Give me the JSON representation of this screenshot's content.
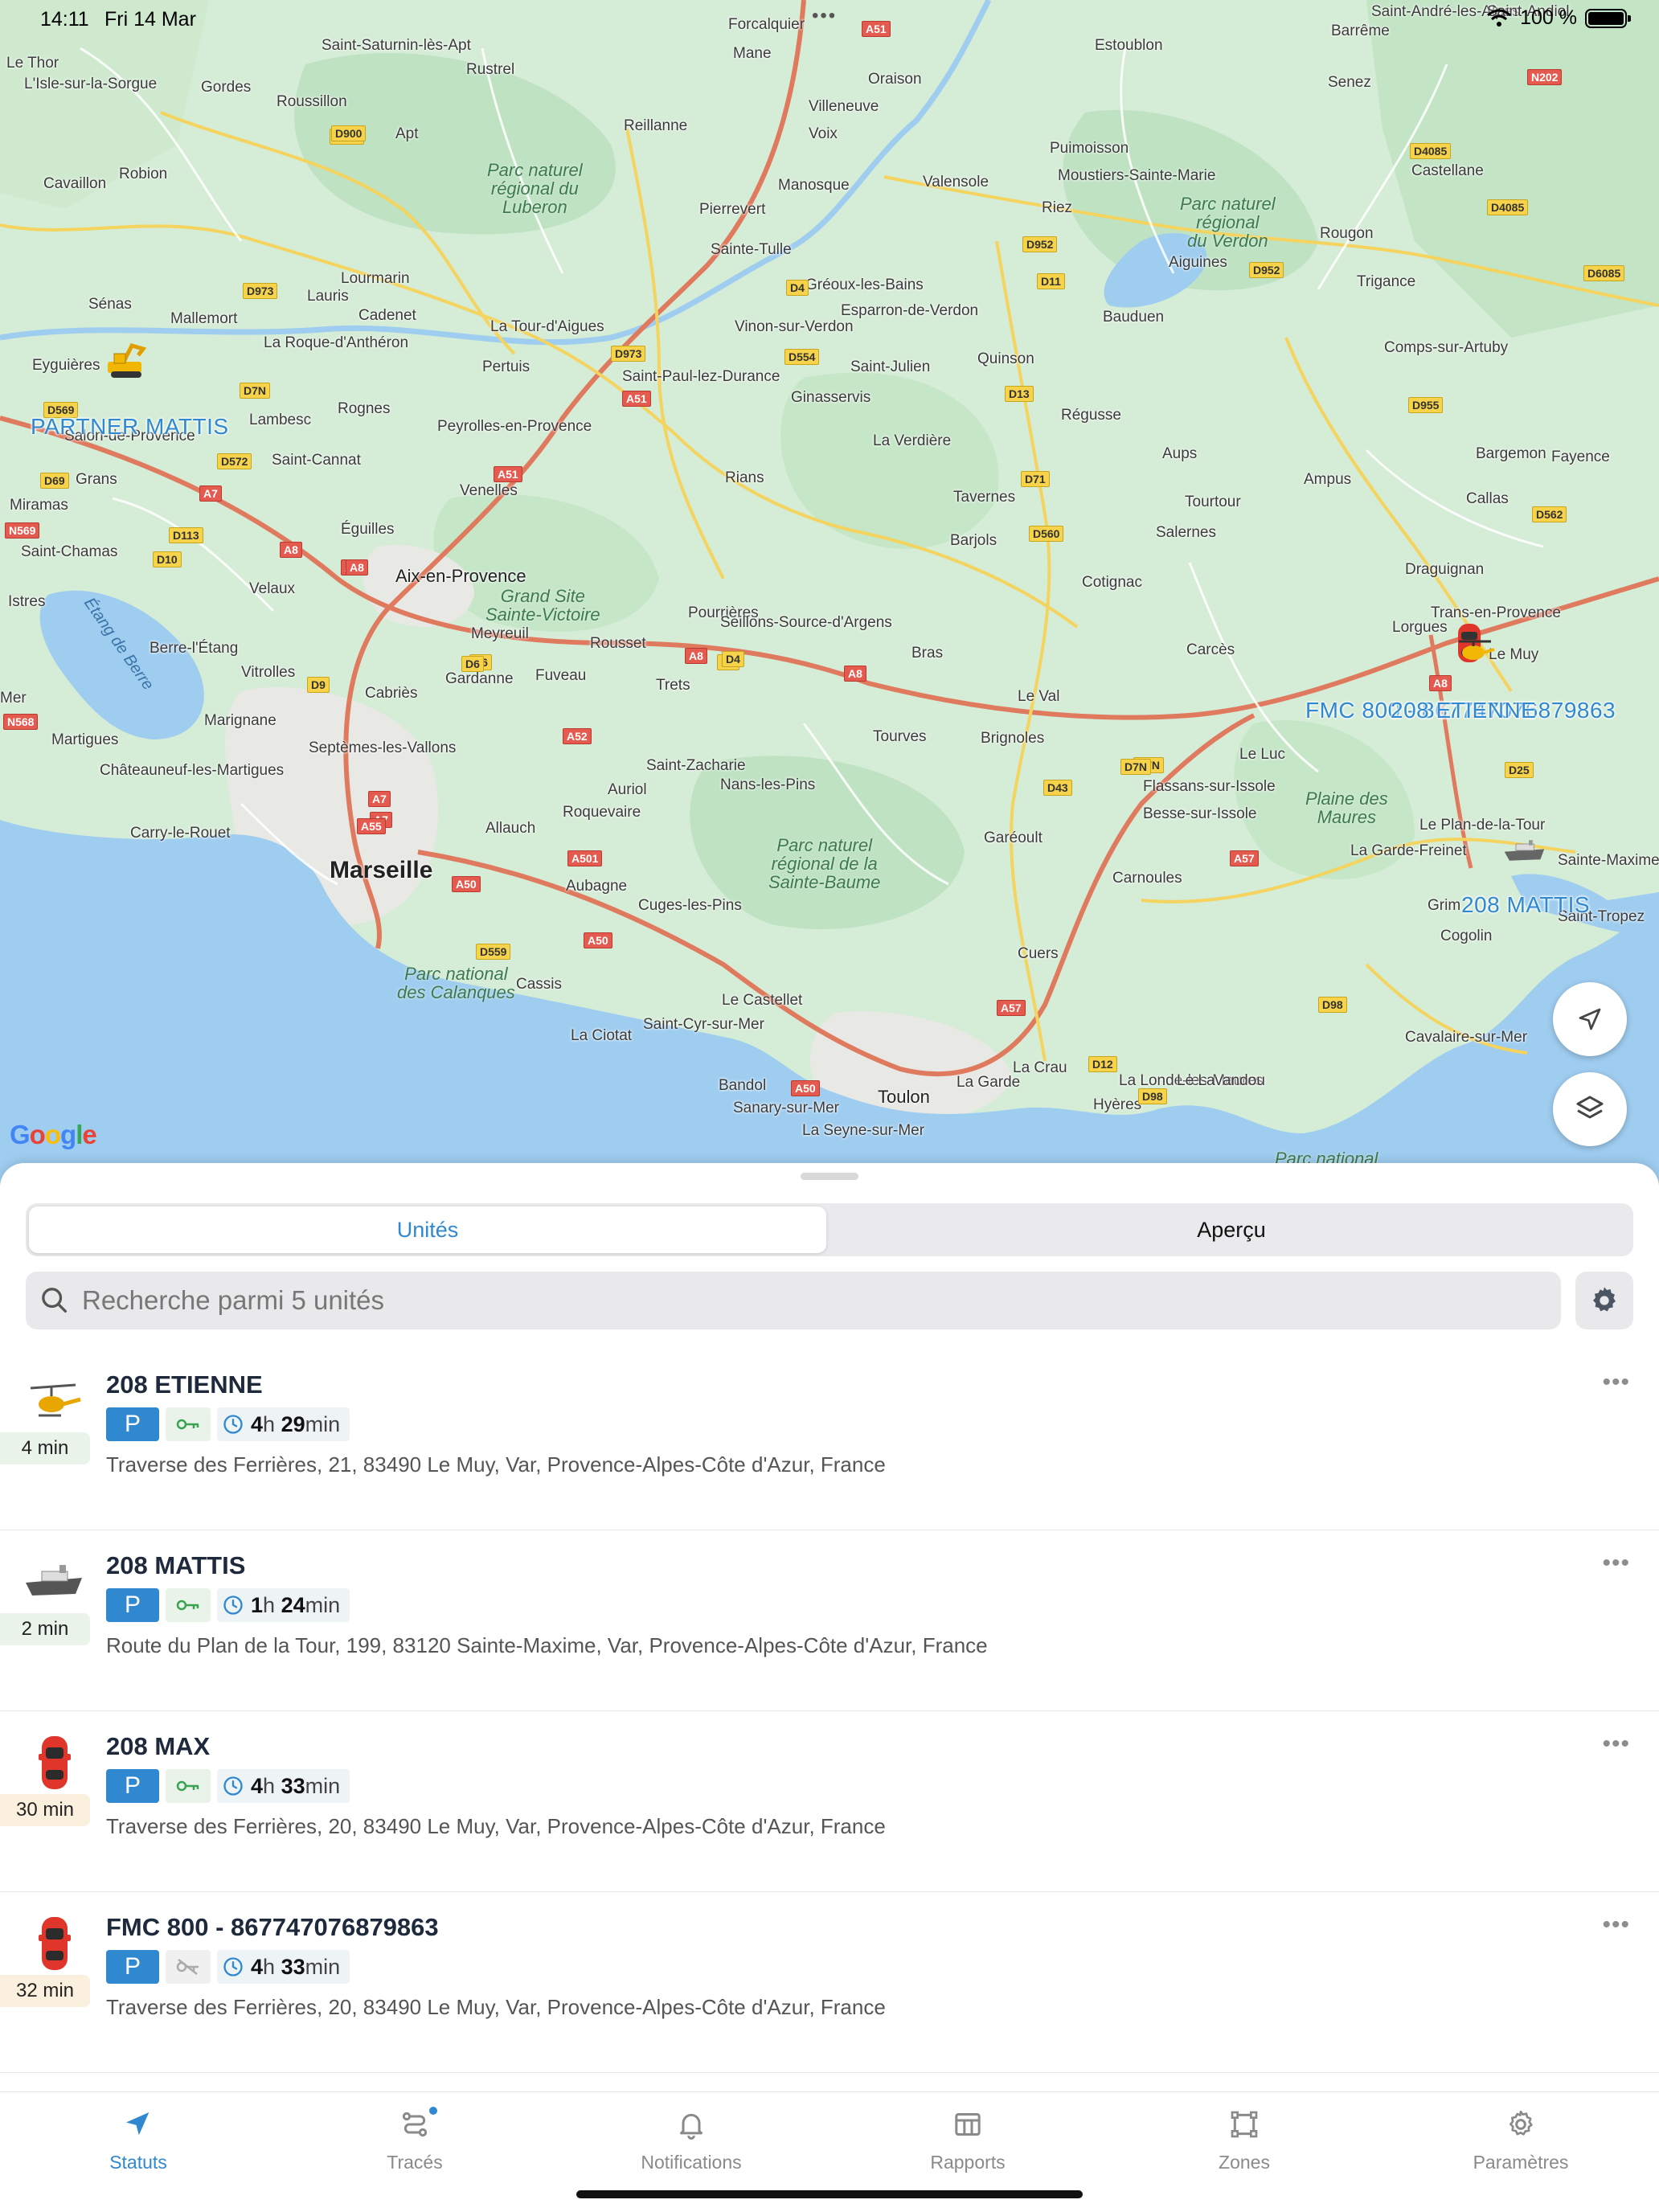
{
  "statusbar": {
    "time": "14:11",
    "date": "Fri 14 Mar",
    "battery": "100 %"
  },
  "map": {
    "places": [
      {
        "t": "Le Thor"
      },
      {
        "t": "L'Isle-sur-la-Sorgue"
      },
      {
        "t": "Gordes"
      },
      {
        "t": "Saint-Saturnin-lès-Apt"
      },
      {
        "t": "Rustrel"
      },
      {
        "t": "Roussillon"
      },
      {
        "t": "Apt"
      },
      {
        "t": "Reillanne"
      },
      {
        "t": "Forcalquier"
      },
      {
        "t": "Mane"
      },
      {
        "t": "Oraison"
      },
      {
        "t": "Villeneuve"
      },
      {
        "t": "Voix"
      },
      {
        "t": "Estoublon"
      },
      {
        "t": "Barrême"
      },
      {
        "t": "Senez"
      },
      {
        "t": "Saint-André-les-Alpes"
      },
      {
        "t": "Robion"
      },
      {
        "t": "Cavaillon"
      },
      {
        "t": "Manosque"
      },
      {
        "t": "Valensole"
      },
      {
        "t": "Pierrevert"
      },
      {
        "t": "Puimoisson"
      },
      {
        "t": "Moustiers-Sainte-Marie"
      },
      {
        "t": "Castellane"
      },
      {
        "t": "Riez"
      },
      {
        "t": "Sainte-Tulle"
      },
      {
        "t": "Rougon"
      },
      {
        "t": "Gréoux-les-Bains"
      },
      {
        "t": "Esparron-de-Verdon"
      },
      {
        "t": "Aiguines"
      },
      {
        "t": "Trigance"
      },
      {
        "t": "Bauduen"
      },
      {
        "t": "Lourmarin"
      },
      {
        "t": "Lauris"
      },
      {
        "t": "Cadenet"
      },
      {
        "t": "Sénas"
      },
      {
        "t": "Mallemort"
      },
      {
        "t": "La Roque-d'Anthéron"
      },
      {
        "t": "La Tour-d'Aigues"
      },
      {
        "t": "Vinon-sur-Verdon"
      },
      {
        "t": "Quinson"
      },
      {
        "t": "Comps-sur-Artuby"
      },
      {
        "t": "Eyguières"
      },
      {
        "t": "Pertuis"
      },
      {
        "t": "Saint-Paul-lez-Durance"
      },
      {
        "t": "Saint-Julien"
      },
      {
        "t": "Ginasservis"
      },
      {
        "t": "Lambesc"
      },
      {
        "t": "Rognes"
      },
      {
        "t": "Salon-de-Provence"
      },
      {
        "t": "Peyrolles-en-Provence"
      },
      {
        "t": "Régusse"
      },
      {
        "t": "La Verdière"
      },
      {
        "t": "Aups"
      },
      {
        "t": "Saint-Cannat"
      },
      {
        "t": "Bargemon"
      },
      {
        "t": "Fayence"
      },
      {
        "t": "Grans"
      },
      {
        "t": "Venelles"
      },
      {
        "t": "Rians"
      },
      {
        "t": "Ampus"
      },
      {
        "t": "Tavernes"
      },
      {
        "t": "Callas"
      },
      {
        "t": "Miramas"
      },
      {
        "t": "Éguilles"
      },
      {
        "t": "Barjols"
      },
      {
        "t": "Tourtour"
      },
      {
        "t": "Salernes"
      },
      {
        "t": "Saint-Chamas"
      },
      {
        "t": "Draguignan"
      },
      {
        "t": "Velaux"
      },
      {
        "t": "Cotignac"
      },
      {
        "t": "Istres"
      },
      {
        "t": "Pourrières"
      },
      {
        "t": "Trans-en-Provence"
      },
      {
        "t": "Meyreuil"
      },
      {
        "t": "Seillons-Source-d'Argens"
      },
      {
        "t": "Lorgues"
      },
      {
        "t": "Berre-l'Étang"
      },
      {
        "t": "Rousset"
      },
      {
        "t": "Carcès"
      },
      {
        "t": "Bras"
      },
      {
        "t": "Le Muy"
      },
      {
        "t": "Vitrolles"
      },
      {
        "t": "Gardanne"
      },
      {
        "t": "Fuveau"
      },
      {
        "t": "Trets"
      },
      {
        "t": "Cabriès"
      },
      {
        "t": "Le Val"
      },
      {
        "t": "Mer"
      },
      {
        "t": "Marignane"
      },
      {
        "t": "Martigues"
      },
      {
        "t": "Septèmes-les-Vallons"
      },
      {
        "t": "Tourves"
      },
      {
        "t": "Brignoles"
      },
      {
        "t": "Le Luc"
      },
      {
        "t": "Saint-Zacharie"
      },
      {
        "t": "Châteauneuf-les-Martigues"
      },
      {
        "t": "Nans-les-Pins"
      },
      {
        "t": "Auriol"
      },
      {
        "t": "Flassans-sur-Issole"
      },
      {
        "t": "Roquevaire"
      },
      {
        "t": "Besse-sur-Issole"
      },
      {
        "t": "Allauch"
      },
      {
        "t": "Carry-le-Rouet"
      },
      {
        "t": "Garéoult"
      },
      {
        "t": "Le Plan-de-la-Tour"
      },
      {
        "t": "La Garde-Freinet"
      },
      {
        "t": "Sainte-Maxime"
      },
      {
        "t": "Aubagne"
      },
      {
        "t": "Carnoules"
      },
      {
        "t": "Cuges-les-Pins"
      },
      {
        "t": "Grim"
      },
      {
        "t": "Saint-Tropez"
      },
      {
        "t": "Cogolin"
      },
      {
        "t": "Cuers"
      },
      {
        "t": "Cassis"
      },
      {
        "t": "Le Castellet"
      },
      {
        "t": "Saint-Cyr-sur-Mer"
      },
      {
        "t": "La Ciotat"
      },
      {
        "t": "Cavalaire-sur-Mer"
      },
      {
        "t": "La Crau"
      },
      {
        "t": "Bandol"
      },
      {
        "t": "La Londe-les-Maures"
      },
      {
        "t": "Le Lavandou"
      },
      {
        "t": "Sanary-sur-Mer"
      },
      {
        "t": "La Garde"
      },
      {
        "t": "Hyères"
      },
      {
        "t": "La Seyne-sur-Mer"
      },
      {
        "t": "Saint-Andiol"
      }
    ],
    "city_big": "Marseille",
    "city_mid": [
      "Aix-en-Provence",
      "Toulon"
    ],
    "parks": [
      {
        "t": "Parc naturel\nrégional du\nLuberon"
      },
      {
        "t": "Parc naturel\nrégional\ndu Verdon"
      },
      {
        "t": "Grand Site\nSainte-Victoire"
      },
      {
        "t": "Parc naturel\nrégional de la\nSainte-Baume"
      },
      {
        "t": "Plaine des\nMaures"
      },
      {
        "t": "Parc national\ndes Calanques"
      },
      {
        "t": "Parc national"
      }
    ],
    "sea_label": "Étang de Berre",
    "shields_yellow": [
      "D900",
      "D900",
      "D973",
      "D973",
      "D4",
      "D554",
      "D952",
      "D952",
      "D11",
      "D13",
      "D71",
      "D560",
      "D569",
      "D7N",
      "D572",
      "D69",
      "D113",
      "D10",
      "D6",
      "D6",
      "D7N",
      "D9",
      "D4085",
      "D4085",
      "D6085",
      "D955",
      "D562",
      "D25",
      "D43",
      "D7N",
      "D559",
      "D98",
      "D12",
      "D98",
      "D6",
      "D4"
    ],
    "shields_red": [
      "A51",
      "A51",
      "A51",
      "A7",
      "A8",
      "A8",
      "A8",
      "A8",
      "A7",
      "A52",
      "A7",
      "A55",
      "A501",
      "A50",
      "A50",
      "A50",
      "A8",
      "A57",
      "A57",
      "A8",
      "N569",
      "N568",
      "N202"
    ],
    "google": "Google",
    "unit_labels": [
      "PARTNER MATTIS",
      "FMC 800 - 867747076879863",
      "208 ETIENNE",
      "208 MATTIS"
    ]
  },
  "sheet": {
    "tabs": [
      {
        "label": "Unités"
      },
      {
        "label": "Aperçu"
      }
    ],
    "search": {
      "placeholder": "Recherche parmi 5 unités"
    },
    "units": [
      {
        "name": "208 ETIENNE",
        "ago": "4 min",
        "badge_p": "P",
        "dur_h": "4",
        "dur_h_unit": "h",
        "dur_m": "29",
        "dur_m_unit": "min",
        "addr": "Traverse des Ferrières, 21, 83490 Le Muy, Var, Provence-Alpes-Côte d'Azur, France",
        "more": "•••",
        "icon": "helicopter-icon",
        "ago_color": "green",
        "key_on": true
      },
      {
        "name": "208 MATTIS",
        "ago": "2 min",
        "badge_p": "P",
        "dur_h": "1",
        "dur_h_unit": "h",
        "dur_m": "24",
        "dur_m_unit": "min",
        "addr": "Route du Plan de la Tour, 199, 83120 Sainte-Maxime, Var, Provence-Alpes-Côte d'Azur, France",
        "more": "•••",
        "icon": "ship-icon",
        "ago_color": "green",
        "key_on": true
      },
      {
        "name": "208 MAX",
        "ago": "30 min",
        "badge_p": "P",
        "dur_h": "4",
        "dur_h_unit": "h",
        "dur_m": "33",
        "dur_m_unit": "min",
        "addr": "Traverse des Ferrières, 20, 83490 Le Muy, Var, Provence-Alpes-Côte d'Azur, France",
        "more": "•••",
        "icon": "car-icon",
        "ago_color": "orange",
        "key_on": true
      },
      {
        "name": "FMC 800 - 867747076879863",
        "ago": "32 min",
        "badge_p": "P",
        "dur_h": "4",
        "dur_h_unit": "h",
        "dur_m": "33",
        "dur_m_unit": "min",
        "addr": "Traverse des Ferrières, 20, 83490 Le Muy, Var, Provence-Alpes-Côte d'Azur, France",
        "more": "•••",
        "icon": "car-icon",
        "ago_color": "orange",
        "key_on": false
      }
    ]
  },
  "tabbar": [
    {
      "label": "Statuts",
      "icon": "navigation-arrow-icon"
    },
    {
      "label": "Tracés",
      "icon": "route-icon"
    },
    {
      "label": "Notifications",
      "icon": "bell-icon"
    },
    {
      "label": "Rapports",
      "icon": "table-icon"
    },
    {
      "label": "Zones",
      "icon": "zone-icon"
    },
    {
      "label": "Paramètres",
      "icon": "gear-icon"
    }
  ],
  "colors": {
    "accent": "#2f88d0",
    "water": "#9fcdf0",
    "park": "#bfe2c3",
    "land": "#d5ecd6",
    "road_yellow": "#f4d35e",
    "motorway": "#e07a5f"
  }
}
